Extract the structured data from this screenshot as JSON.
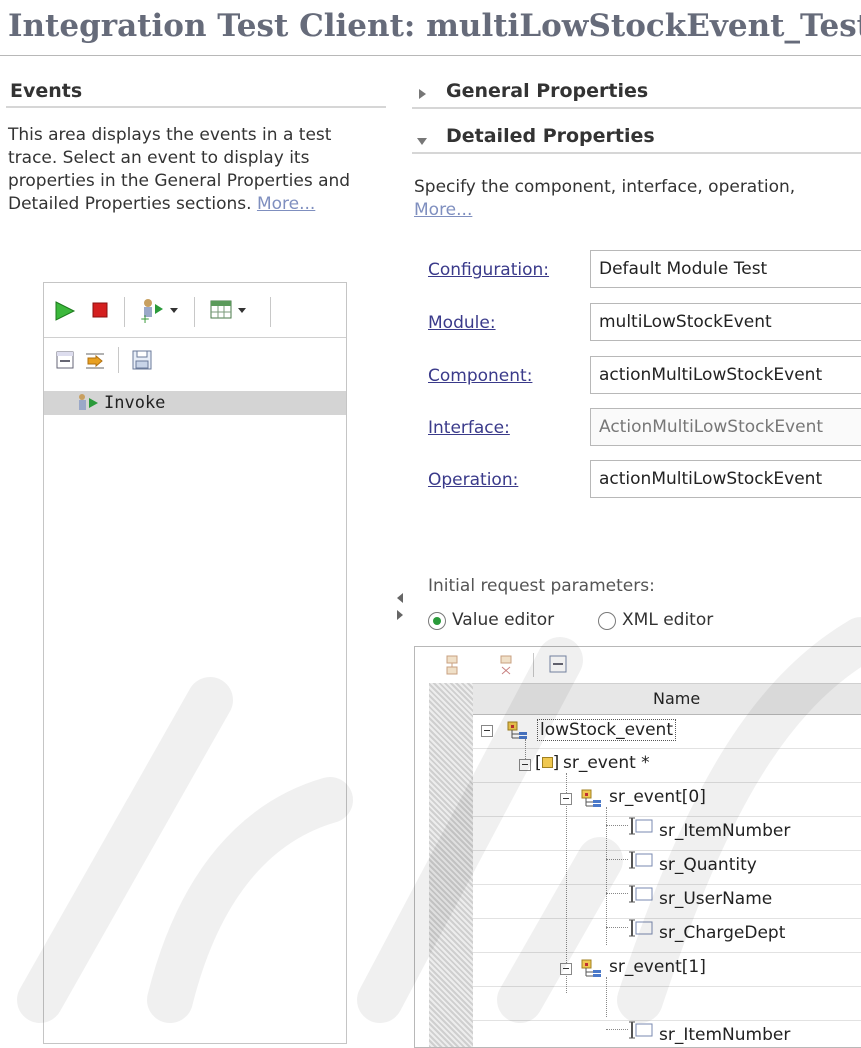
{
  "window": {
    "title": "Integration Test Client: multiLowStockEvent_Test"
  },
  "events": {
    "heading": "Events",
    "description": "This area displays the events in a test trace. Select an event to display its properties in the General Properties and Detailed Properties sections.",
    "more_link": "More...",
    "selected_event": "Invoke"
  },
  "general_properties": {
    "heading": "General Properties"
  },
  "detailed_properties": {
    "heading": "Detailed Properties",
    "description": "Specify the component, interface, operation,",
    "more_link": "More...",
    "fields": [
      {
        "label": "Configuration:",
        "value": "Default Module Test"
      },
      {
        "label": "Module:",
        "value": "multiLowStockEvent"
      },
      {
        "label": "Component:",
        "value": "actionMultiLowStockEvent"
      },
      {
        "label": "Interface:",
        "value": "ActionMultiLowStockEvent"
      },
      {
        "label": "Operation:",
        "value": "actionMultiLowStockEvent"
      }
    ],
    "initial_request_label": "Initial request parameters:",
    "editor_modes": [
      {
        "label": "Value editor",
        "selected": true
      },
      {
        "label": "XML editor",
        "selected": false
      }
    ],
    "table": {
      "column_header": "Name",
      "rows": [
        {
          "name": "lowStock_event"
        },
        {
          "name": "sr_event *"
        },
        {
          "name": "sr_event[0]"
        },
        {
          "name": "sr_ItemNumber"
        },
        {
          "name": "sr_Quantity"
        },
        {
          "name": "sr_UserName"
        },
        {
          "name": "sr_ChargeDept"
        },
        {
          "name": "sr_event[1]"
        },
        {
          "name": "sr_ItemNumber"
        }
      ]
    }
  },
  "colors": {
    "title": "#666b7a",
    "link": "#3a3a8a",
    "run": "#3cb83c",
    "stop": "#d42020"
  }
}
